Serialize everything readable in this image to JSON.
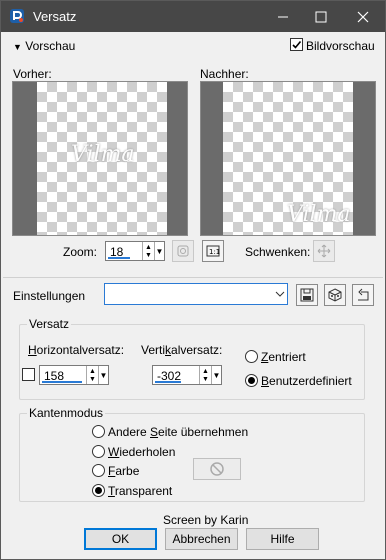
{
  "window": {
    "title": "Versatz"
  },
  "preview_section": {
    "toggle_label": "Vorschau",
    "image_preview_label": "Bildvorschau",
    "image_preview_checked": true
  },
  "before": {
    "label": "Vorher:",
    "watermark": "Vilma"
  },
  "after": {
    "label": "Nachher:",
    "watermark": "Vilma"
  },
  "zoom": {
    "label": "Zoom:",
    "value": "18"
  },
  "pan": {
    "label": "Schwenken:"
  },
  "settings": {
    "label": "Einstellungen",
    "value": ""
  },
  "offset": {
    "title": "Versatz",
    "horizontal_label": "Horizontalversatz:",
    "horizontal_value": "158",
    "vertical_label": "Vertikalversatz:",
    "vertical_value": "-302",
    "centered_label": "Zentriert",
    "custom_label": "Benutzerdefiniert",
    "selected": "custom"
  },
  "edge_mode": {
    "title": "Kantenmodus",
    "options": [
      "Andere Seite übernehmen",
      "Wiederholen",
      "Farbe",
      "Transparent"
    ],
    "selected_index": 3
  },
  "credit": "Screen by Karin",
  "buttons": {
    "ok": "OK",
    "cancel": "Abbrechen",
    "help": "Hilfe"
  }
}
